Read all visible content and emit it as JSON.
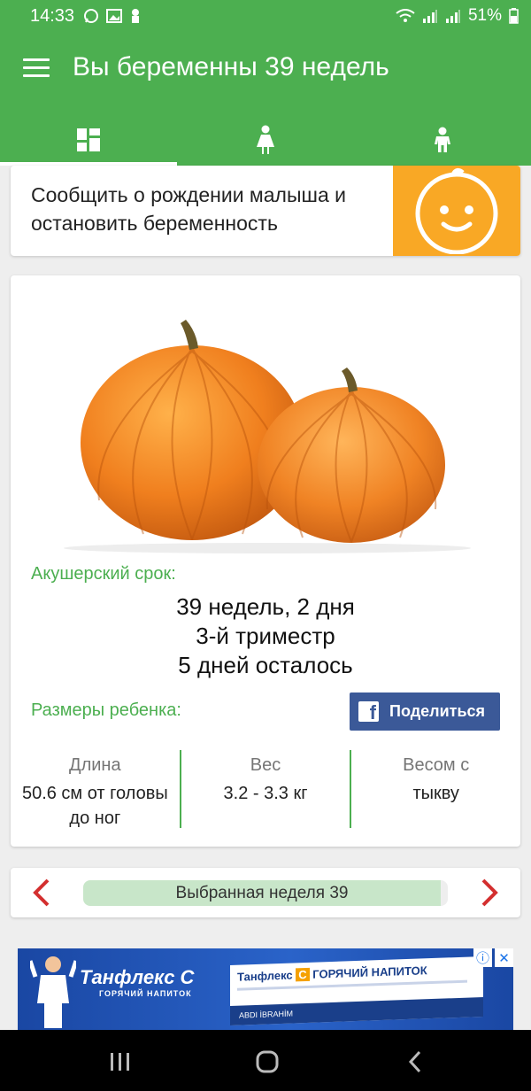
{
  "status": {
    "time": "14:33",
    "battery": "51%"
  },
  "appbar": {
    "title": "Вы беременны 39 недель"
  },
  "tabs": [
    {
      "name": "dashboard",
      "icon": "grid-icon"
    },
    {
      "name": "mother",
      "icon": "woman-icon"
    },
    {
      "name": "baby",
      "icon": "child-icon"
    }
  ],
  "birth_card": {
    "text": "Сообщить о рождении малыша и остановить беременность",
    "icon": "baby-face-icon"
  },
  "info": {
    "obstetric_label": "Акушерский срок:",
    "term": "39 недель, 2 дня",
    "trimester": "3-й триместр",
    "remaining": "5 дней осталось",
    "sizes_label": "Размеры ребенка:",
    "share_label": "Поделиться",
    "metrics": [
      {
        "label": "Длина",
        "value": "50.6 см от головы до ног"
      },
      {
        "label": "Вес",
        "value": "3.2 - 3.3 кг"
      },
      {
        "label": "Весом с",
        "value": "тыкву"
      }
    ]
  },
  "week_selector": {
    "label": "Выбранная неделя 39"
  },
  "ad": {
    "brand": "Танфлекс С",
    "brand_sub": "ГОРЯЧИЙ НАПИТОК",
    "pack_title_left": "Танфлекс ",
    "pack_title_c": "С",
    "pack_title_right": " ГОРЯЧИЙ НАПИТОК",
    "pack_band": "ABDI İBRAHİM"
  },
  "colors": {
    "primary": "#4caf50",
    "accent_orange": "#f9a825",
    "facebook": "#3b5998",
    "arrow_red": "#d32f2f"
  }
}
